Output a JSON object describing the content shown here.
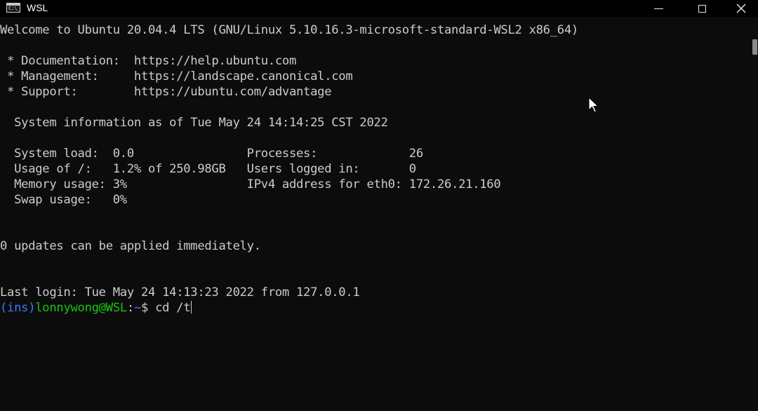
{
  "window": {
    "title": "WSL",
    "app_icon_text": "C:\\_",
    "controls": [
      "minimize-icon",
      "maximize-icon",
      "close-icon"
    ]
  },
  "terminal": {
    "lines": [
      "Welcome to Ubuntu 20.04.4 LTS (GNU/Linux 5.10.16.3-microsoft-standard-WSL2 x86_64)",
      "",
      " * Documentation:  https://help.ubuntu.com",
      " * Management:     https://landscape.canonical.com",
      " * Support:        https://ubuntu.com/advantage",
      "",
      "  System information as of Tue May 24 14:14:25 CST 2022",
      "",
      "  System load:  0.0                Processes:             26",
      "  Usage of /:   1.2% of 250.98GB   Users logged in:       0",
      "  Memory usage: 3%                 IPv4 address for eth0: 172.26.21.160",
      "  Swap usage:   0%",
      "",
      "",
      "0 updates can be applied immediately.",
      "",
      "",
      "Last login: Tue May 24 14:13:23 2022 from 127.0.0.1"
    ],
    "prompt": {
      "venv": "(ins)",
      "user_host": "lonnywong@WSL",
      "separator": ":",
      "path": "~",
      "symbol": "$ ",
      "command": "cd /t"
    }
  },
  "colors": {
    "background": "#0c0c0c",
    "foreground": "#cccccc",
    "venv": "#3b78ff",
    "user_host": "#16c60c",
    "path": "#3b78ff"
  }
}
